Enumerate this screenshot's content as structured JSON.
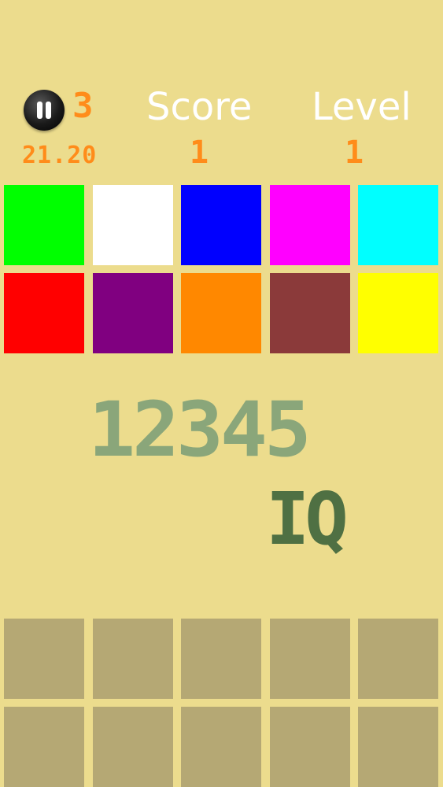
{
  "header": {
    "pause_icon": "pause-icon",
    "lives": "3",
    "timer": "21.20",
    "score_label": "Score",
    "score_value": "1",
    "level_label": "Level",
    "level_value": "1",
    "accent_color": "#ff8c1a"
  },
  "palette": [
    {
      "name": "green",
      "color": "#00ff00"
    },
    {
      "name": "white",
      "color": "#ffffff"
    },
    {
      "name": "blue",
      "color": "#0000ff"
    },
    {
      "name": "magenta",
      "color": "#ff00ff"
    },
    {
      "name": "cyan",
      "color": "#00ffff"
    },
    {
      "name": "red",
      "color": "#ff0000"
    },
    {
      "name": "purple",
      "color": "#800080"
    },
    {
      "name": "orange",
      "color": "#ff8800"
    },
    {
      "name": "brown",
      "color": "#8b3a3a"
    },
    {
      "name": "yellow",
      "color": "#ffff00"
    }
  ],
  "board": {
    "sequence": "12345",
    "iq_label": "IQ"
  },
  "answer_slots": {
    "count": 10,
    "color": "#b5a874"
  },
  "background_color": "#ecdc8d"
}
